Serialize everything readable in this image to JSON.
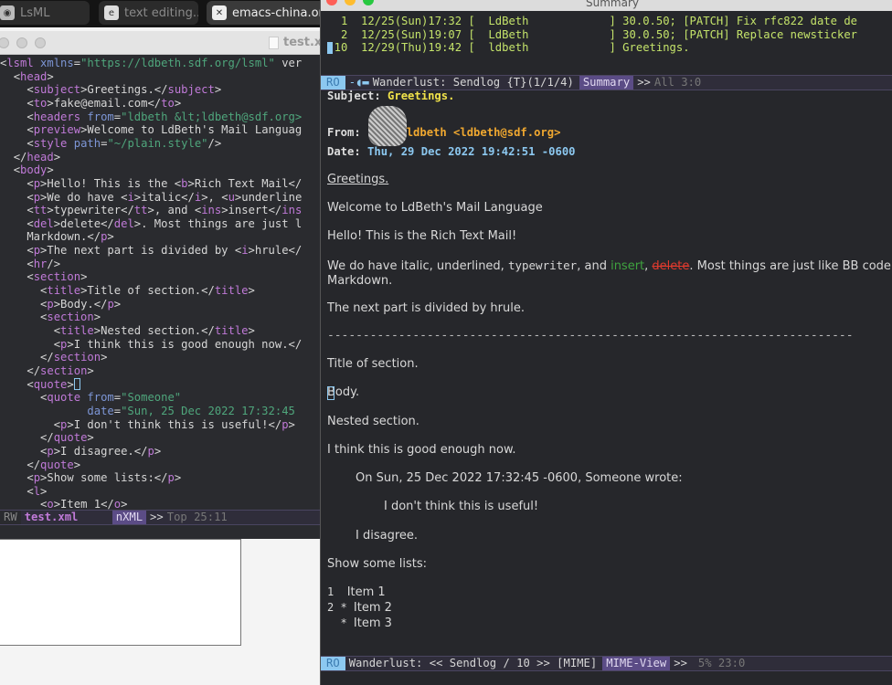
{
  "browser_tabs": [
    {
      "label": "LsML",
      "icon": "owl-icon"
    },
    {
      "label": "text editing...",
      "icon": "e-icon"
    },
    {
      "label": "emacs-china.org",
      "icon": "close-icon"
    }
  ],
  "left_window": {
    "title": "test.xml",
    "lines": [
      "<lsml xmlns=\"https://ldbeth.sdf.org/lsml\" ver",
      "  <head>",
      "    <subject>Greetings.</subject>",
      "    <to>fake@email.com</to>",
      "    <headers from=\"ldbeth &lt;ldbeth@sdf.org>",
      "    <preview>Welcome to LdBeth's Mail Languag",
      "    <style path=\"~/plain.style\"/>",
      "  </head>",
      "  <body>",
      "    <p>Hello! This is the <b>Rich Text Mail</",
      "    <p>We do have <i>italic</i>, <u>underline",
      "    <tt>typewriter</tt>, and <ins>insert</ins",
      "    <del>delete</del>. Most things are just l",
      "    Markdown.</p>",
      "    <p>The next part is divided by <i>hrule</",
      "    <hr/>",
      "    <section>",
      "      <title>Title of section.</title>",
      "      <p>Body.</p>",
      "      <section>",
      "        <title>Nested section.</title>",
      "        <p>I think this is good enough now.</",
      "      </section>",
      "    </section>",
      "    <quote>",
      "      <quote from=\"Someone\"",
      "             date=\"Sun, 25 Dec 2022 17:32:45",
      "        <p>I don't think this is useful!</p>",
      "      </quote>",
      "      <p>I disagree.</p>",
      "    </quote>",
      "    <p>Show some lists:</p>",
      "    <l>",
      "      <o>Item 1</o>"
    ],
    "modeline": {
      "state": "RW",
      "buffer": "test.xml",
      "mode": "nXML",
      "sep": ">>",
      "position": "Top 25:11"
    }
  },
  "right_window": {
    "title": "Summary",
    "summary_lines": [
      "   1  12/25(Sun)17:32 [  LdBeth            ] 30.0.50; [PATCH] Fix rfc822 date de",
      "   2  12/25(Sun)19:07 [  LdBeth            ] 30.0.50; [PATCH] Replace newsticker",
      "  10  12/29(Thu)19:42 [  ldbeth            ] Greetings."
    ],
    "summary_modeline": {
      "state": "RO",
      "buffer": "Wanderlust: Sendlog {T}(1/1/4)",
      "mode": "Summary",
      "sep": ">>",
      "position": "All 3:0"
    },
    "headers": {
      "subject_label": "Subject:",
      "subject": "Greetings.",
      "from_label": "From:",
      "from": "ldbeth <ldbeth@sdf.org>",
      "date_label": "Date:",
      "date": "Thu, 29 Dec 2022 19:42:51 -0600"
    },
    "body": {
      "title": "Greetings.",
      "preview": "Welcome to LdBeth's Mail Language",
      "p1": "Hello! This is the Rich Text Mail!",
      "p2a": "We do have italic, underlined, ",
      "p2_tt": "typewriter",
      "p2b": ", and ",
      "p2_ins": "insert",
      "p2c": ", ",
      "p2_del": "delete",
      "p2d": ". Most things are just like BB code or",
      "p2e": "Markdown.",
      "p3": "The next part is divided by hrule.",
      "hrule": "--------------------------------------------------------------------------",
      "section_title": "Title of section.",
      "section_body": "Body.",
      "nested_title": "Nested section.",
      "nested_body": "I think this is good enough now.",
      "quote_attr": "On Sun, 25 Dec 2022 17:32:45 -0600, Someone wrote:",
      "quote_inner": "I don't think this is useful!",
      "quote_reply": "I disagree.",
      "lists_intro": "Show some lists:",
      "list": [
        {
          "marker": "1",
          "text": "Item 1"
        },
        {
          "marker": "2 *",
          "text": "Item 2"
        },
        {
          "marker": "  *",
          "text": "Item 3"
        }
      ]
    },
    "view_modeline": {
      "state": "RO",
      "buffer": "Wanderlust: << Sendlog / 10 >> [MIME]",
      "mode": "MIME-View",
      "sep": ">>",
      "position": "5% 23:0"
    }
  },
  "colors": {
    "tag": "#c07ad8",
    "attr": "#7d96d6",
    "string": "#4fa67c",
    "summary": "#c4e36a",
    "subject": "#f0e24a",
    "from": "#f0a830",
    "date": "#8cc8f0",
    "insert": "#3fa33f",
    "delete": "#e03a2e",
    "modeline_accent": "#5b4c86"
  }
}
